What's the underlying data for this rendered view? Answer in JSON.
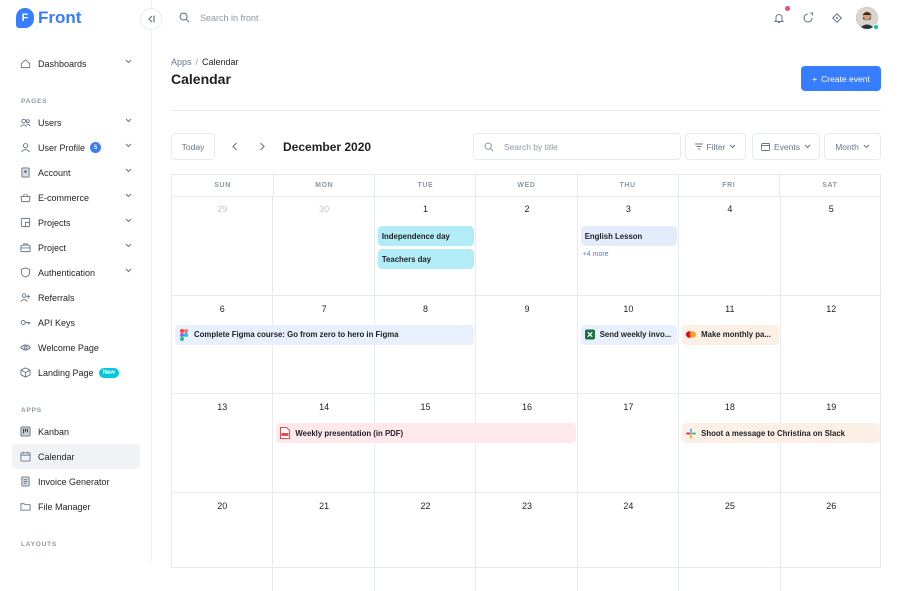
{
  "app": {
    "logo_letter": "F",
    "logo_text": "Front",
    "brand_color": "#377dff"
  },
  "topbar": {
    "search_placeholder": "Search in front"
  },
  "sidebar": {
    "dashboards": "Dashboards",
    "pages_label": "PAGES",
    "pages": [
      {
        "label": "Users",
        "icon": "users-icon",
        "chevron": true
      },
      {
        "label": "User Profile",
        "icon": "user-icon",
        "chevron": true,
        "badge": "5"
      },
      {
        "label": "Account",
        "icon": "account-icon",
        "chevron": true
      },
      {
        "label": "E-commerce",
        "icon": "basket-icon",
        "chevron": true
      },
      {
        "label": "Projects",
        "icon": "projects-icon",
        "chevron": true
      },
      {
        "label": "Project",
        "icon": "briefcase-icon",
        "chevron": true
      },
      {
        "label": "Authentication",
        "icon": "shield-icon",
        "chevron": true
      },
      {
        "label": "Referrals",
        "icon": "person-plus-icon",
        "chevron": false
      },
      {
        "label": "API Keys",
        "icon": "key-icon",
        "chevron": false
      },
      {
        "label": "Welcome Page",
        "icon": "eye-icon",
        "chevron": false
      },
      {
        "label": "Landing Page",
        "icon": "box-icon",
        "chevron": false,
        "badge_new": "New"
      }
    ],
    "apps_label": "APPS",
    "apps": [
      {
        "label": "Kanban",
        "icon": "kanban-icon"
      },
      {
        "label": "Calendar",
        "icon": "calendar-icon",
        "active": true
      },
      {
        "label": "Invoice Generator",
        "icon": "invoice-icon"
      },
      {
        "label": "File Manager",
        "icon": "folder-icon"
      }
    ],
    "layouts_label": "LAYOUTS"
  },
  "breadcrumb": {
    "parent": "Apps",
    "current": "Calendar"
  },
  "page_title": "Calendar",
  "create_button": "Create event",
  "toolbar": {
    "today": "Today",
    "month_title": "December 2020",
    "search_placeholder": "Search by title",
    "filter": "Filter",
    "events": "Events",
    "view": "Month"
  },
  "calendar": {
    "weekdays": [
      "SUN",
      "MON",
      "TUE",
      "WED",
      "THU",
      "FRI",
      "SAT"
    ],
    "weeks": [
      [
        {
          "d": "29",
          "muted": true
        },
        {
          "d": "30",
          "muted": true
        },
        {
          "d": "1"
        },
        {
          "d": "2"
        },
        {
          "d": "3"
        },
        {
          "d": "4"
        },
        {
          "d": "5"
        }
      ],
      [
        {
          "d": "6"
        },
        {
          "d": "7"
        },
        {
          "d": "8"
        },
        {
          "d": "9"
        },
        {
          "d": "10"
        },
        {
          "d": "11"
        },
        {
          "d": "12"
        }
      ],
      [
        {
          "d": "13"
        },
        {
          "d": "14"
        },
        {
          "d": "15"
        },
        {
          "d": "16"
        },
        {
          "d": "17"
        },
        {
          "d": "18"
        },
        {
          "d": "19"
        }
      ],
      [
        {
          "d": "20"
        },
        {
          "d": "21"
        },
        {
          "d": "22"
        },
        {
          "d": "23"
        },
        {
          "d": "24"
        },
        {
          "d": "25"
        },
        {
          "d": "26"
        }
      ]
    ],
    "events": [
      {
        "title": "Independence day",
        "week": 0,
        "start": 2,
        "span": 1,
        "slot": 0,
        "color": "#b2ecf7",
        "icon": null
      },
      {
        "title": "Teachers day",
        "week": 0,
        "start": 2,
        "span": 1,
        "slot": 1,
        "color": "#b2ecf7",
        "icon": null
      },
      {
        "title": "English Lesson",
        "week": 0,
        "start": 4,
        "span": 1,
        "slot": 0,
        "color": "#e4ecfb",
        "icon": null
      },
      {
        "title": "Complete Figma course: Go from zero to hero in Figma",
        "week": 1,
        "start": 0,
        "span": 3,
        "slot": 0,
        "color": "#e8f0fe",
        "icon": "figma-icon"
      },
      {
        "title": "Send weekly invo...",
        "week": 1,
        "start": 4,
        "span": 1,
        "slot": 0,
        "color": "#e8f0fe",
        "icon": "excel-icon"
      },
      {
        "title": "Make monthly pa...",
        "week": 1,
        "start": 5,
        "span": 1,
        "slot": 0,
        "color": "#fcefe6",
        "icon": "mastercard-icon"
      },
      {
        "title": "Weekly presentation (in PDF)",
        "week": 2,
        "start": 1,
        "span": 3,
        "slot": 0,
        "color": "#fde9ec",
        "icon": "pdf-icon"
      },
      {
        "title": "Shoot a message to Christina on Slack",
        "week": 2,
        "start": 5,
        "span": 2,
        "slot": 0,
        "color": "#fcefe6",
        "icon": "slack-icon"
      }
    ],
    "more_link": {
      "label": "+4 more",
      "week": 0,
      "day": 4
    }
  }
}
